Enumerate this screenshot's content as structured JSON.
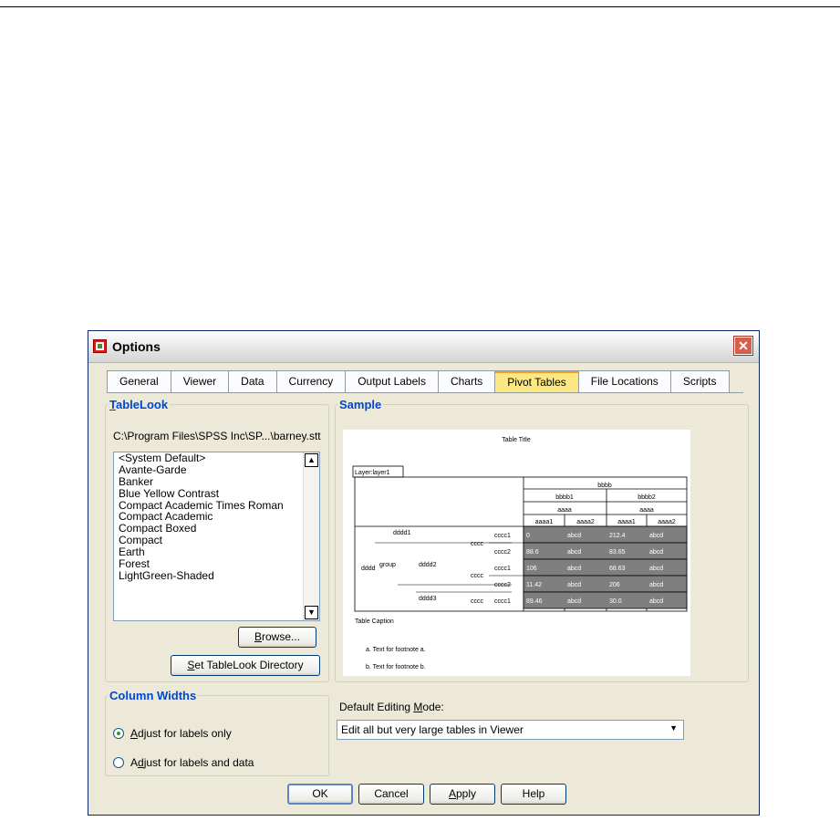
{
  "window": {
    "title": "Options",
    "close_glyph": "✕"
  },
  "tabs": [
    "General",
    "Viewer",
    "Data",
    "Currency",
    "Output Labels",
    "Charts",
    "Pivot Tables",
    "File Locations",
    "Scripts"
  ],
  "active_tab": "Pivot Tables",
  "tablelook": {
    "legend": "TableLook",
    "path": "C:\\Program Files\\SPSS Inc\\SP...\\barney.stt",
    "items": [
      "<System Default>",
      "Avante-Garde",
      "Banker",
      "Blue Yellow Contrast",
      "Compact Academic Times Roman",
      "Compact Academic",
      "Compact Boxed",
      "Compact",
      "Earth",
      "Forest",
      "LightGreen-Shaded"
    ],
    "browse_label": "Browse...",
    "set_dir_label": "Set TableLook Directory"
  },
  "sample": {
    "legend": "Sample",
    "table_title": "Table Title",
    "layer": "Layer:layer1",
    "col_top": "bbbb",
    "col_sub": [
      "bbbb1",
      "bbbb2"
    ],
    "col_mid": [
      "aaaa",
      "aaaa"
    ],
    "col_leaf": [
      "aaaa1",
      "aaaa2",
      "aaaa1",
      "aaaa2"
    ],
    "row_d": "dddd",
    "row_group": "group",
    "row_dd": [
      "dddd1",
      "dddd2",
      "dddd3"
    ],
    "row_cccc": "cccc",
    "row_leaf": [
      "cccc1",
      "cccc2",
      "cccc1",
      "cccc2",
      "cccc1"
    ],
    "values": [
      [
        "0",
        "abcd",
        "212.4",
        "abcd"
      ],
      [
        "88.6",
        "abcd",
        "83.65",
        "abcd"
      ],
      [
        "106",
        "abcd",
        "68.63",
        "abcd"
      ],
      [
        "11.42",
        "abcd",
        "206",
        "abcd"
      ],
      [
        "89.46",
        "abcd",
        "30.0",
        "abcd"
      ]
    ],
    "caption": "Table Caption",
    "footnotes": [
      "a. Text for footnote a.",
      "b. Text for footnote b."
    ]
  },
  "column_widths": {
    "legend": "Column Widths",
    "options": [
      "Adjust for labels only",
      "Adjust for labels and data"
    ],
    "selected_index": 0
  },
  "editing_mode": {
    "label": "Default Editing Mode:",
    "value": "Edit all but very large tables in Viewer"
  },
  "buttons": {
    "ok": "OK",
    "cancel": "Cancel",
    "apply": "Apply",
    "help": "Help"
  },
  "colors": {
    "shaded_cell": "#7f7f7f",
    "active_tab": "#fce883",
    "legend_blue": "#0046d5"
  }
}
